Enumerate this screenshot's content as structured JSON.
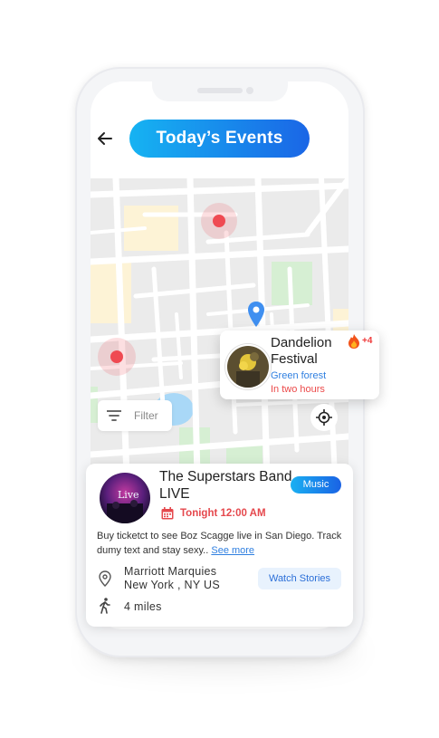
{
  "header": {
    "title": "Today’s Events"
  },
  "map": {
    "event_popup": {
      "name": "Dandelion Festival",
      "place": "Green forest",
      "time": "In two hours",
      "extra_count": "+4"
    },
    "filter_label": "Filter"
  },
  "card": {
    "title": "The  Superstars Band LIVE",
    "tag": "Music",
    "time": "Tonight 12:00 AM",
    "description": "Buy ticketct to see Boz Scagge live in San Diego. Track dumy text and stay sexy..",
    "more_link": "See more",
    "venue_line1": "Marriott Marquies",
    "venue_line2": "New York , NY US",
    "watch_button": "Watch Stories",
    "distance": "4 miles",
    "avatar_text": "Live"
  },
  "colors": {
    "accent_start": "#16b3f2",
    "accent_end": "#1a66e6",
    "alert_red": "#e5484d",
    "link_blue": "#2f7fe0"
  }
}
